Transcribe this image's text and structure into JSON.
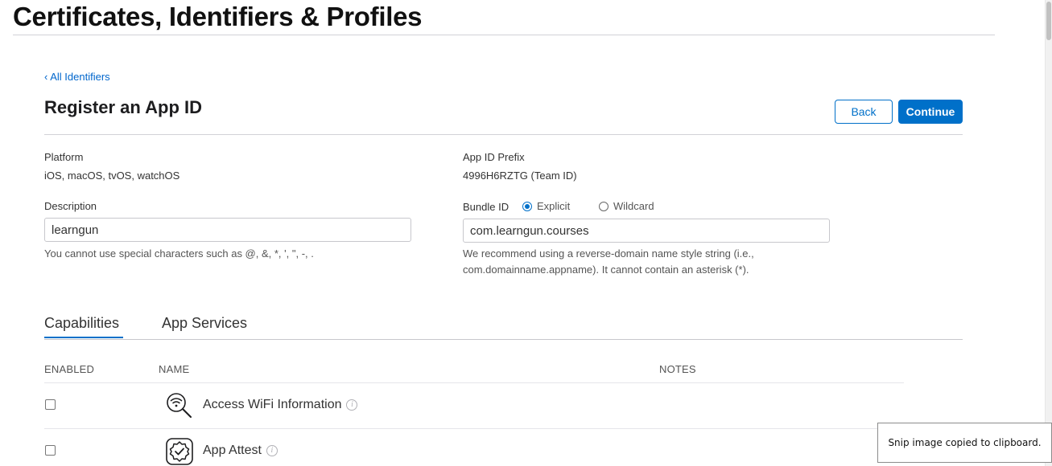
{
  "page": {
    "title": "Certificates, Identifiers & Profiles"
  },
  "nav": {
    "back_link": "‹ All Identifiers"
  },
  "form": {
    "heading": "Register an App ID",
    "back_label": "Back",
    "continue_label": "Continue",
    "platform": {
      "label": "Platform",
      "value": "iOS, macOS, tvOS, watchOS"
    },
    "app_id_prefix": {
      "label": "App ID Prefix",
      "value": "4996H6RZTG (Team ID)"
    },
    "description": {
      "label": "Description",
      "value": "learngun",
      "hint": "You cannot use special characters such as @, &, *, ', \", -, ."
    },
    "bundle_id": {
      "label": "Bundle ID",
      "options": [
        "Explicit",
        "Wildcard"
      ],
      "selected": "Explicit",
      "value": "com.learngun.courses",
      "hint_line1": "We recommend using a reverse-domain name style string (i.e.,",
      "hint_line2": "com.domainname.appname). It cannot contain an asterisk (*)."
    }
  },
  "tabs": [
    {
      "label": "Capabilities",
      "active": true
    },
    {
      "label": "App Services",
      "active": false
    }
  ],
  "table": {
    "columns": [
      "ENABLED",
      "NAME",
      "NOTES"
    ],
    "rows": [
      {
        "name": "Access WiFi Information",
        "enabled": false,
        "icon": "wifi-search-icon"
      },
      {
        "name": "App Attest",
        "enabled": false,
        "icon": "app-attest-badge-icon"
      }
    ]
  },
  "toast": {
    "message": "Snip image copied to clipboard."
  },
  "colors": {
    "accent": "#0070c9",
    "link": "#0066cc",
    "divider": "#d2d2d7"
  }
}
